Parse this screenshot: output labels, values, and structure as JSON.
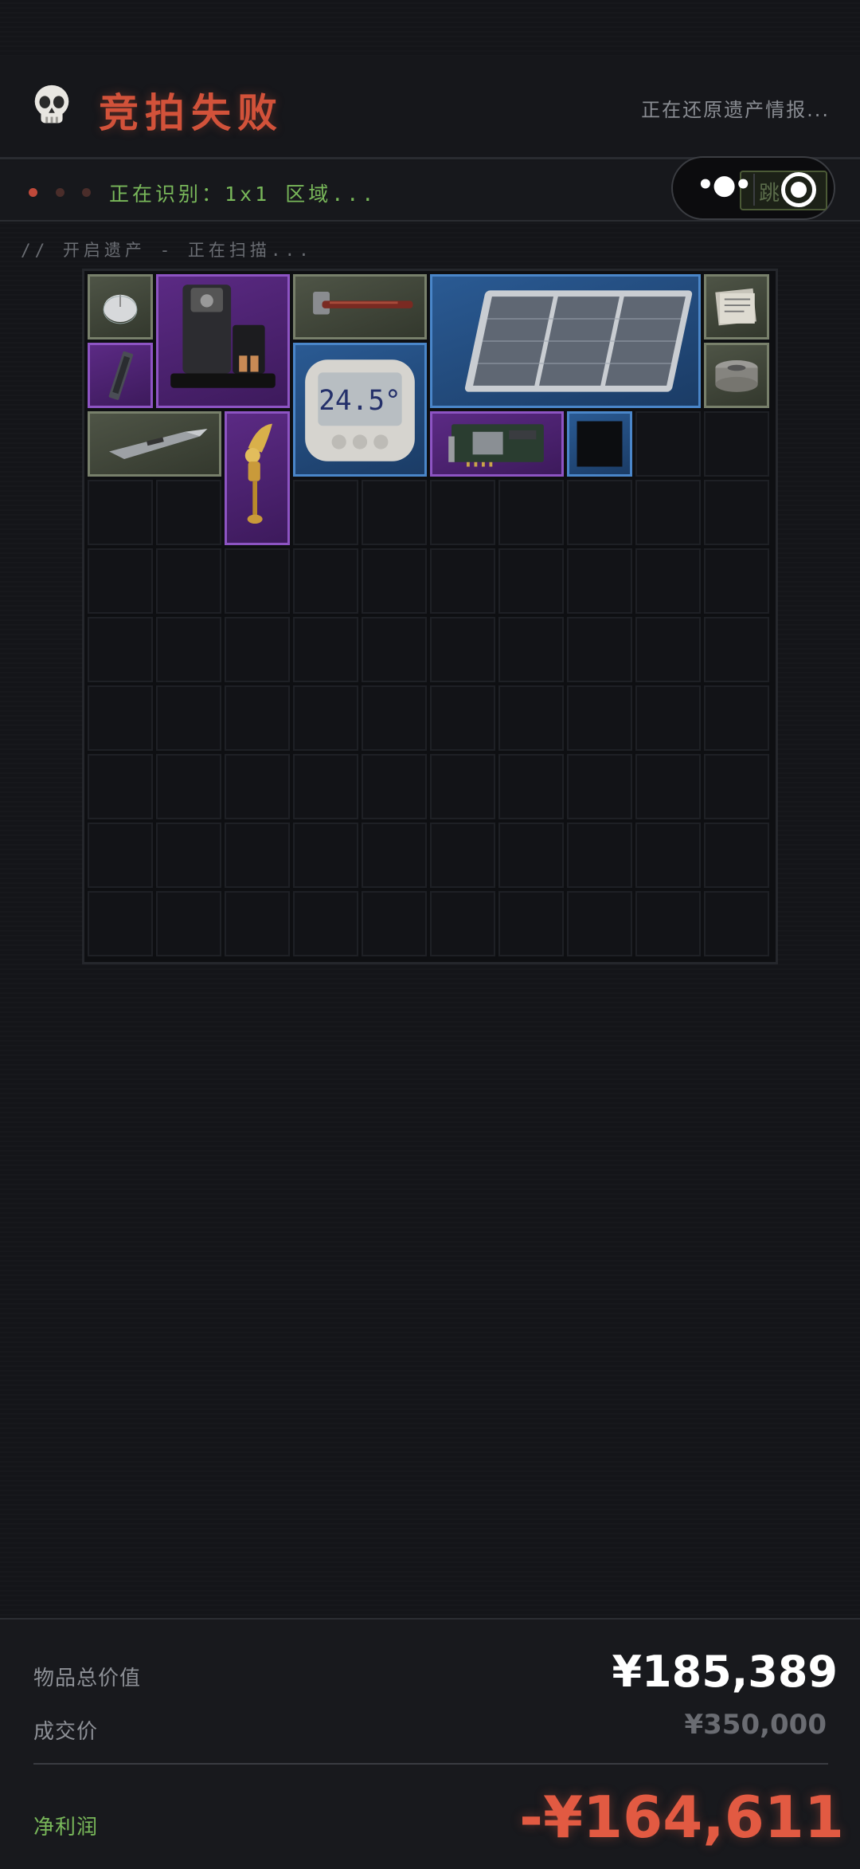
{
  "header": {
    "title": "竞拍失败",
    "restore_status": "正在还原遗产情报..."
  },
  "status_bar": {
    "recognizing": "正在识别：1x1 区域...",
    "skip_label": "跳"
  },
  "scan_line": "// 开启遗产 - 正在扫描...",
  "inventory": {
    "columns": 10,
    "rows": 10,
    "items": [
      {
        "name": "computer-mouse",
        "rarity": "green"
      },
      {
        "name": "coffee-machine",
        "rarity": "purple"
      },
      {
        "name": "hammer",
        "rarity": "green"
      },
      {
        "name": "solar-panel",
        "rarity": "blue"
      },
      {
        "name": "newspaper-stack",
        "rarity": "green"
      },
      {
        "name": "ram-stick",
        "rarity": "purple"
      },
      {
        "name": "digital-thermometer",
        "rarity": "blue",
        "display": "24.5°"
      },
      {
        "name": "duct-tape",
        "rarity": "green"
      },
      {
        "name": "utility-knife",
        "rarity": "green"
      },
      {
        "name": "golden-statue",
        "rarity": "purple"
      },
      {
        "name": "graphics-card",
        "rarity": "purple"
      },
      {
        "name": "unknown-item",
        "rarity": "blue"
      }
    ]
  },
  "summary": {
    "total_value_label": "物品总价值",
    "total_value": "¥185,389",
    "deal_price_label": "成交价",
    "deal_price": "¥350,000",
    "net_profit_label": "净利润",
    "net_profit": "-¥164,611"
  },
  "colors": {
    "title": "#d2523a",
    "status_green": "#79b85a",
    "rarity_green": "#78806b",
    "rarity_purple": "#8d54c3",
    "rarity_blue": "#4a86c9",
    "loss_red": "#e25a42"
  }
}
